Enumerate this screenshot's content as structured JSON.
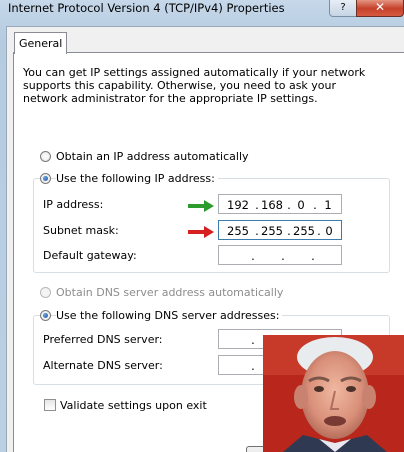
{
  "window": {
    "title": "Internet Protocol Version 4 (TCP/IPv4) Properties",
    "help_glyph": "?",
    "close_glyph": "✕"
  },
  "tabs": [
    {
      "label": "General"
    }
  ],
  "intro_text": "You can get IP settings assigned automatically if your network supports this capability. Otherwise, you need to ask your network administrator for the appropriate IP settings.",
  "ip_settings": {
    "auto_label": "Obtain an IP address automatically",
    "manual_label": "Use the following IP address:",
    "fields": [
      {
        "label": "IP address:",
        "octets": [
          "192",
          "168",
          "0",
          "1"
        ]
      },
      {
        "label": "Subnet mask:",
        "octets": [
          "255",
          "255",
          "255",
          "0"
        ]
      },
      {
        "label": "Default gateway:",
        "octets": [
          "",
          "",
          "",
          ""
        ]
      }
    ]
  },
  "dns_settings": {
    "auto_label": "Obtain DNS server address automatically",
    "manual_label": "Use the following DNS server addresses:",
    "fields": [
      {
        "label": "Preferred DNS server:",
        "octets": [
          "",
          "",
          "",
          ""
        ]
      },
      {
        "label": "Alternate DNS server:",
        "octets": [
          "",
          "",
          "",
          ""
        ]
      }
    ]
  },
  "validate_label": "Validate settings upon exit",
  "annotation_colors": {
    "green_arrow": "#2e9b2e",
    "red_arrow": "#d42020"
  }
}
